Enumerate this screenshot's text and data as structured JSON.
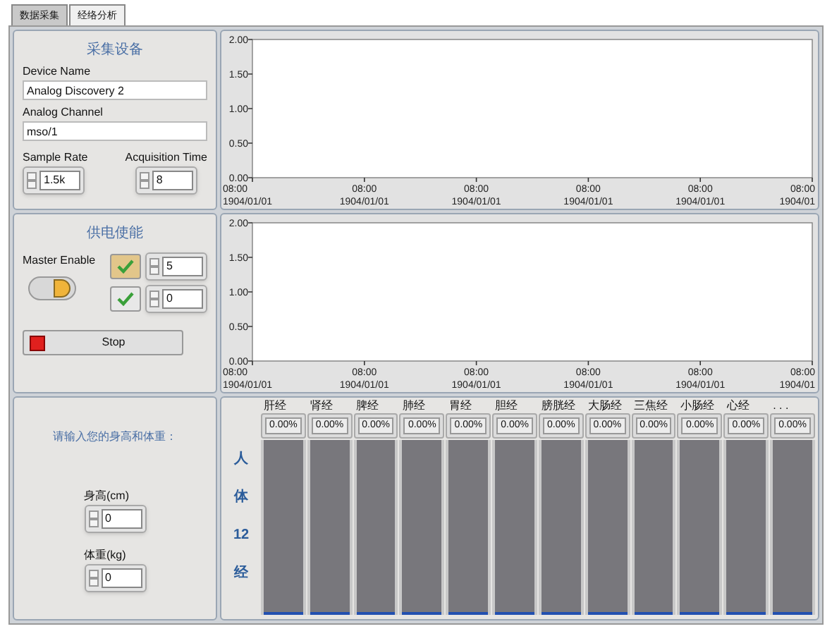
{
  "tabs": [
    {
      "label": "数据采集",
      "selected": true
    },
    {
      "label": "经络分析",
      "selected": false
    }
  ],
  "device_panel": {
    "title": "采集设备",
    "device_name": {
      "label": "Device Name",
      "value": "Analog Discovery 2"
    },
    "analog_channel": {
      "label": "Analog Channel",
      "value": "mso/1"
    },
    "sample_rate": {
      "label": "Sample Rate",
      "value": "1.5k"
    },
    "acquisition_time": {
      "label": "Acquisition Time",
      "value": "8"
    }
  },
  "charts": [
    {
      "chart_data": {
        "type": "line",
        "ylim": [
          0,
          2
        ],
        "yticks": [
          {
            "value": 0,
            "label": "0.00"
          },
          {
            "value": 0.5,
            "label": "0.50"
          },
          {
            "value": 1,
            "label": "1.00"
          },
          {
            "value": 1.5,
            "label": "1.50"
          },
          {
            "value": 2,
            "label": "2.00"
          }
        ],
        "categories": [
          "08:00 1904/01/01",
          "08:00 1904/01/01",
          "08:00 1904/01/01",
          "08:00 1904/01/01",
          "08:00 1904/01/01",
          "08:00 1904/01"
        ]
      }
    },
    {
      "chart_data": {
        "type": "line",
        "ylim": [
          0,
          2
        ],
        "yticks": [
          {
            "value": 0,
            "label": "0.00"
          },
          {
            "value": 0.5,
            "label": "0.50"
          },
          {
            "value": 1,
            "label": "1.00"
          },
          {
            "value": 1.5,
            "label": "1.50"
          },
          {
            "value": 2,
            "label": "2.00"
          }
        ],
        "categories": [
          "08:00 1904/01/01",
          "08:00 1904/01/01",
          "08:00 1904/01/01",
          "08:00 1904/01/01",
          "08:00 1904/01/01",
          "08:00 1904/01"
        ]
      }
    }
  ],
  "power_panel": {
    "title": "供电使能",
    "master_enable": {
      "label": "Master Enable",
      "on": true
    },
    "outputs": [
      {
        "checked": true,
        "highlighted": true,
        "value": "5"
      },
      {
        "checked": true,
        "highlighted": false,
        "value": "0"
      }
    ],
    "stop_button": "Stop"
  },
  "body_panel": {
    "prompt": "请输入您的身高和体重：",
    "height": {
      "label": "身高(cm)",
      "value": "0"
    },
    "weight": {
      "label": "体重(kg)",
      "value": "0"
    }
  },
  "meridians": {
    "side_label": [
      "人",
      "体",
      "12",
      "经"
    ],
    "channels": [
      {
        "name": "肝经",
        "reading": "0.00%",
        "level": 0
      },
      {
        "name": "肾经",
        "reading": "0.00%",
        "level": 0
      },
      {
        "name": "脾经",
        "reading": "0.00%",
        "level": 0
      },
      {
        "name": "肺经",
        "reading": "0.00%",
        "level": 0
      },
      {
        "name": "胃经",
        "reading": "0.00%",
        "level": 0
      },
      {
        "name": "胆经",
        "reading": "0.00%",
        "level": 0
      },
      {
        "name": "膀胱经",
        "reading": "0.00%",
        "level": 0
      },
      {
        "name": "大肠经",
        "reading": "0.00%",
        "level": 0
      },
      {
        "name": "三焦经",
        "reading": "0.00%",
        "level": 0
      },
      {
        "name": "小肠经",
        "reading": "0.00%",
        "level": 0
      },
      {
        "name": "心经",
        "reading": "0.00%",
        "level": 0
      },
      {
        "name": ". . .",
        "reading": "0.00%",
        "level": 0
      }
    ]
  }
}
